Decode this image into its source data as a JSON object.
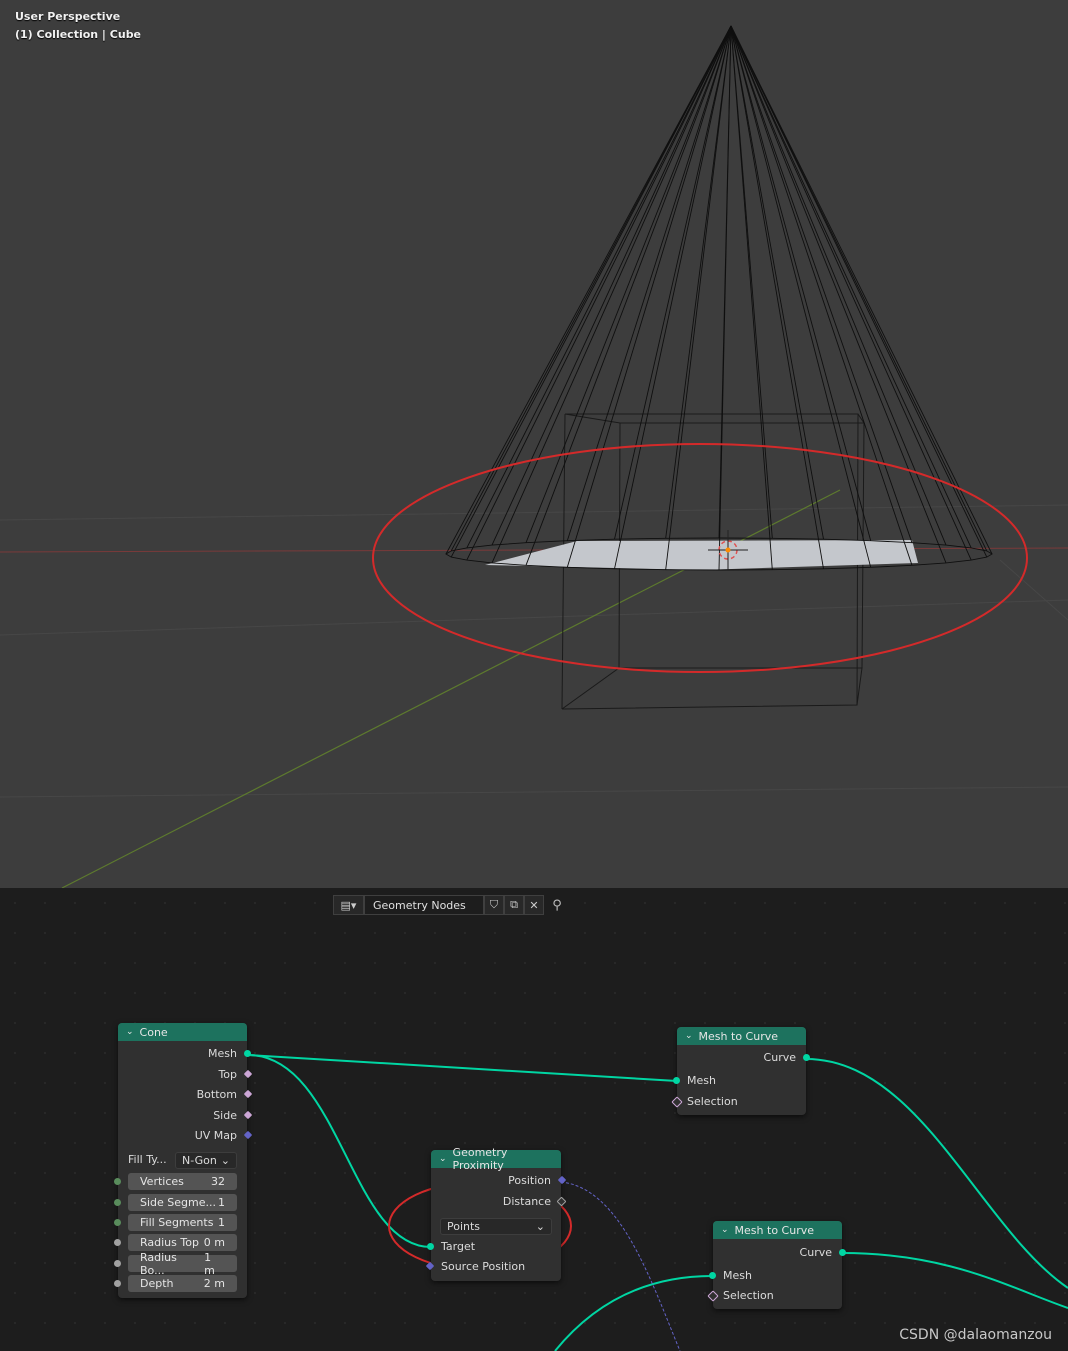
{
  "viewport": {
    "perspective_label": "User Perspective",
    "collection_label": "(1) Collection | Cube"
  },
  "editor_header": {
    "tree_name": "Geometry Nodes",
    "editor_type_icon": "node-editor-icon",
    "icons": [
      "shield-icon",
      "copy-icon",
      "close-icon",
      "pin-icon"
    ]
  },
  "nodes": {
    "cone": {
      "title": "Cone",
      "outputs": [
        "Mesh",
        "Top",
        "Bottom",
        "Side",
        "UV Map"
      ],
      "fill_type_label": "Fill Ty...",
      "fill_type_value": "N-Gon",
      "fields": [
        {
          "label": "Vertices",
          "value": "32"
        },
        {
          "label": "Side Segme...",
          "value": "1"
        },
        {
          "label": "Fill Segments",
          "value": "1"
        },
        {
          "label": "Radius Top",
          "value": "0 m"
        },
        {
          "label": "Radius Bo...",
          "value": "1 m"
        },
        {
          "label": "Depth",
          "value": "2 m"
        }
      ]
    },
    "mesh_to_curve_1": {
      "title": "Mesh to Curve",
      "output": "Curve",
      "inputs": [
        "Mesh",
        "Selection"
      ]
    },
    "geometry_proximity": {
      "title": "Geometry Proximity",
      "outputs": [
        "Position",
        "Distance"
      ],
      "mode_value": "Points",
      "inputs": [
        "Target",
        "Source Position"
      ]
    },
    "mesh_to_curve_2": {
      "title": "Mesh to Curve",
      "output": "Curve",
      "inputs": [
        "Mesh",
        "Selection"
      ]
    }
  },
  "watermark": "CSDN @dalaomanzou",
  "colors": {
    "node_header": "#1d725e",
    "geometry_socket": "#00d6a3",
    "annotation_circle": "#d42a2a",
    "viewport_bg": "#3d3d3d",
    "editor_bg": "#1d1d1d"
  }
}
